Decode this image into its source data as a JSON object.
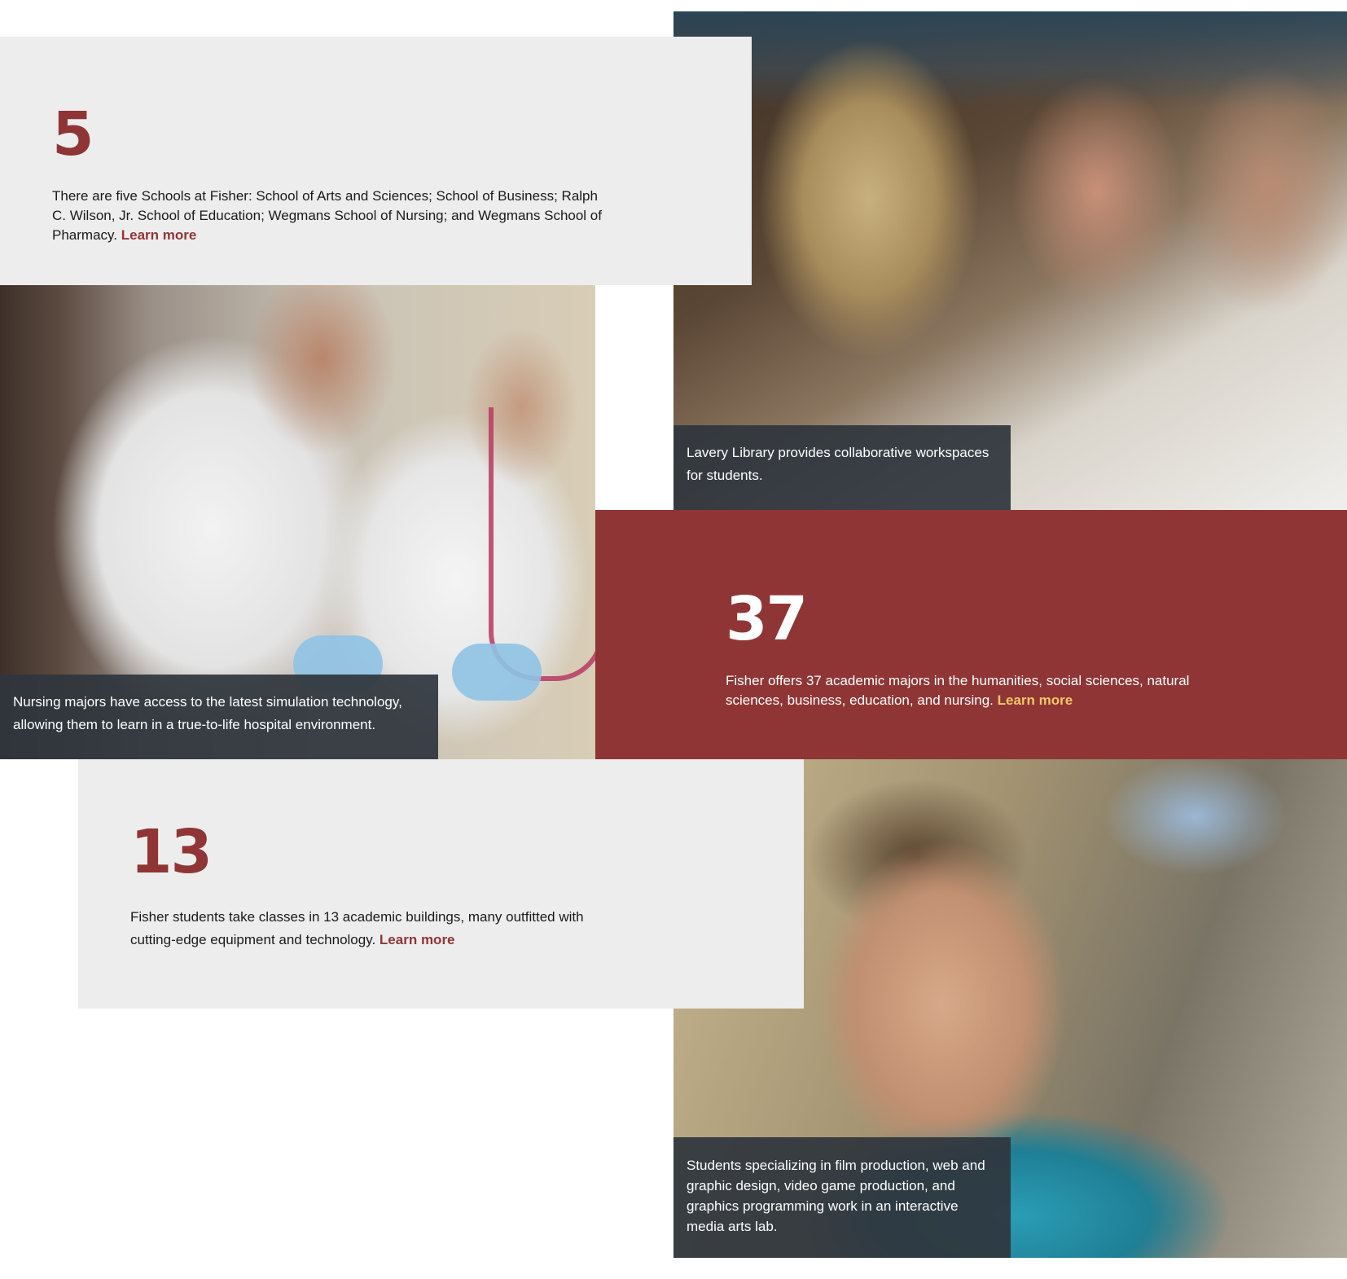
{
  "stats": [
    {
      "number": "5",
      "text": "There are five Schools at Fisher: School of Arts and Sciences; School of Business; Ralph C. Wilson, Jr. School of Education; Wegmans School of Nursing; and Wegmans School of Pharmacy.",
      "link": "Learn more"
    },
    {
      "number": "37",
      "text": "Fisher offers 37 academic majors in the humanities, social sciences, natural sciences, business, education, and nursing.",
      "link": "Learn more"
    },
    {
      "number": "13",
      "text": "Fisher students take classes in 13 academic buildings, many outfitted with cutting-edge equipment and technology.",
      "link": "Learn more"
    }
  ],
  "captions": {
    "library": "Lavery Library provides collaborative workspaces for students.",
    "nursing": "Nursing majors have access to the latest simulation technology, allowing them to learn in a true-to-life hospital environment.",
    "student": "Students specializing in film production, web and graphic design, video game production, and graphics programming work in an interactive media arts lab."
  },
  "colors": {
    "accent": "#8f3535",
    "panel_gray": "#ededed",
    "link_on_accent": "#f2c66b",
    "caption_bg": "#2f363d"
  }
}
